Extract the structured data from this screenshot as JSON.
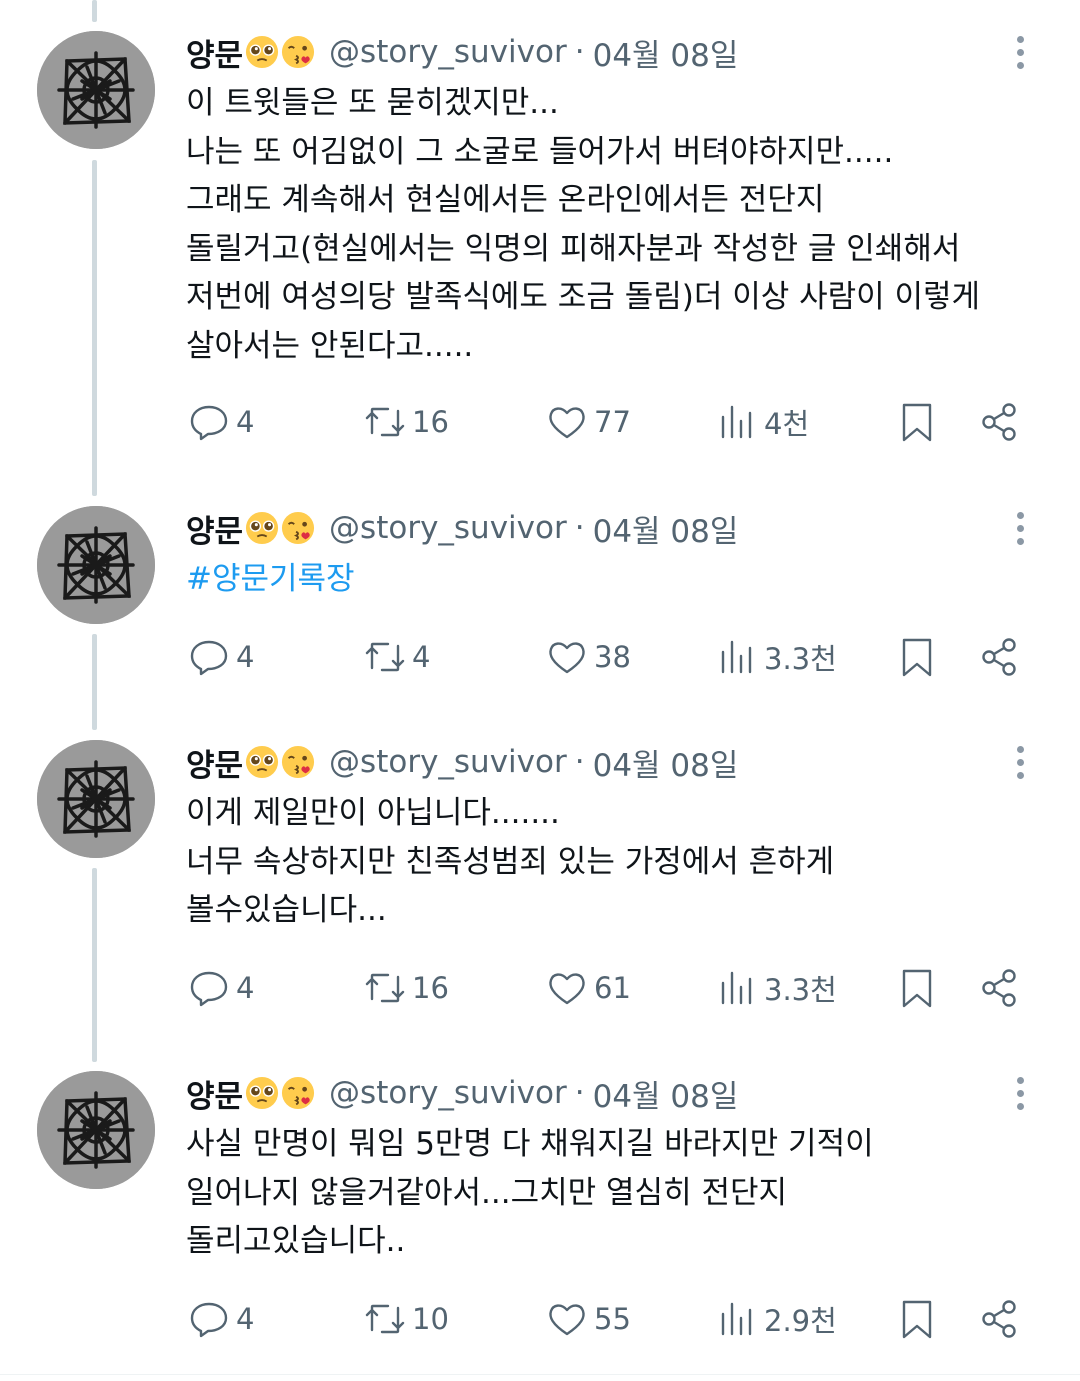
{
  "tweets": [
    {
      "name": "양문",
      "handle": "@story_suvivor",
      "date": "04월 08일",
      "text": "이 트윗들은 또 묻히겠지만...\n나는 또 어김없이 그 소굴로 들어가서 버텨야하지만.....\n그래도 계속해서 현실에서든 온라인에서든 전단지\n돌릴거고(현실에서는 익명의 피해자분과 작성한 글 인쇄해서\n저번에 여성의당 발족식에도 조금 돌림)더 이상 사람이 이렇게\n살아서는 안된다고.....",
      "replies": "4",
      "retweets": "16",
      "likes": "77",
      "views": "4천"
    },
    {
      "name": "양문",
      "handle": "@story_suvivor",
      "date": "04월 08일",
      "text": "#양문기록장",
      "replies": "4",
      "retweets": "4",
      "likes": "38",
      "views": "3.3천"
    },
    {
      "name": "양문",
      "handle": "@story_suvivor",
      "date": "04월 08일",
      "text": "이게 제일만이 아닙니다.......\n너무 속상하지만 친족성범죄 있는 가정에서 흔하게\n볼수있습니다...",
      "replies": "4",
      "retweets": "16",
      "likes": "61",
      "views": "3.3천"
    },
    {
      "name": "양문",
      "handle": "@story_suvivor",
      "date": "04월 08일",
      "text": "사실 만명이 뭐임 5만명 다 채워지길 바라지만 기적이\n일어나지 않을거같아서...그치만 열심히 전단지\n돌리고있습니다..",
      "replies": "4",
      "retweets": "10",
      "likes": "55",
      "views": "2.9천"
    }
  ],
  "separator": "·",
  "colors": {
    "text": "#0f1419",
    "muted": "#536471",
    "link": "#1d9bf0",
    "thread": "#cfd9de"
  },
  "icons": [
    "reply-icon",
    "retweet-icon",
    "like-icon",
    "views-icon",
    "bookmark-icon",
    "share-icon",
    "more-icon",
    "pleading-face-emoji",
    "kiss-face-emoji"
  ]
}
